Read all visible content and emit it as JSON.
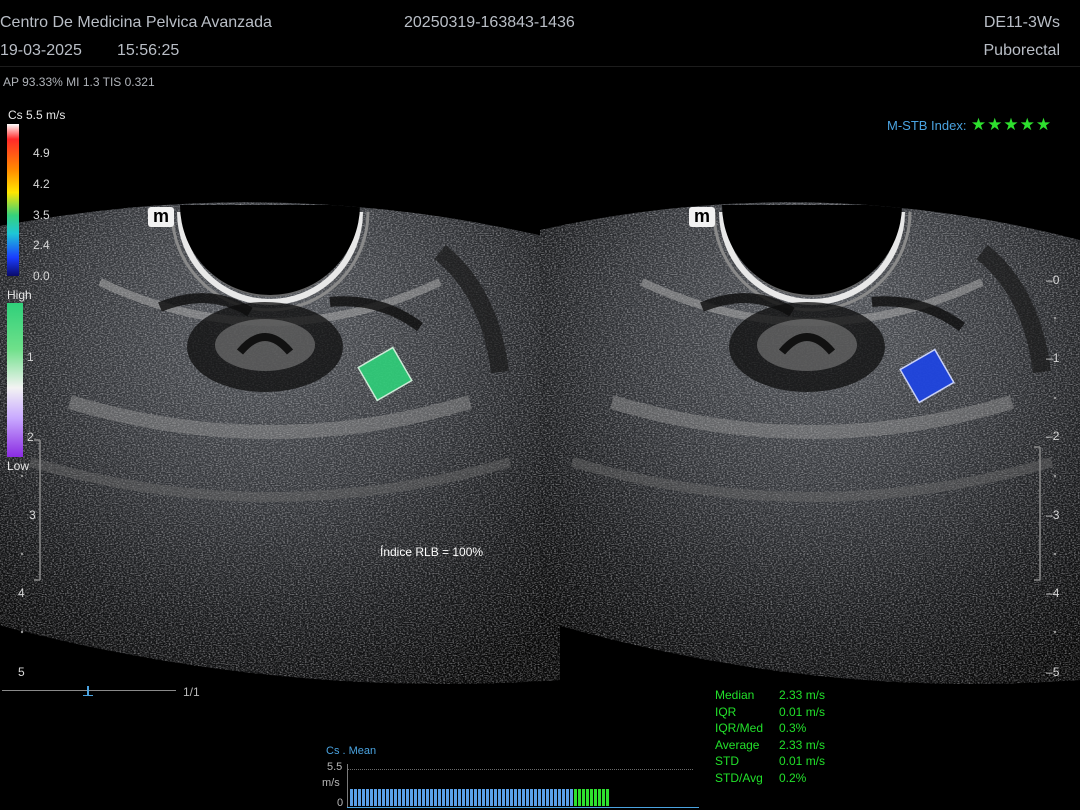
{
  "header": {
    "clinic": "Centro De Medicina Pelvica Avanzada",
    "study_id": "20250319-163843-1436",
    "probe": "DE11-3Ws",
    "date": "19-03-2025",
    "time": "15:56:25",
    "preset": "Puborectal",
    "acoustic": "AP 93.33%  MI 1.3 TIS 0.321"
  },
  "velocity_scale": {
    "title": "Cs 5.5 m/s",
    "ticks": [
      "4.9",
      "4.2",
      "3.5",
      "2.4",
      "0.0"
    ]
  },
  "quality_scale": {
    "high": "High",
    "low": "Low",
    "ticks": [
      "1",
      "2"
    ]
  },
  "stb": {
    "label": "M-STB Index:",
    "stars": "★★★★★",
    "rating": 5
  },
  "left_view": {
    "marker": "m",
    "depth_ticks": [
      "3",
      "4",
      "5"
    ],
    "rlb": "Índice RLB = 100%",
    "roi_color": "#2fd07a"
  },
  "right_view": {
    "marker": "m",
    "depth_ticks": [
      "0",
      "1",
      "2",
      "3",
      "4",
      "5"
    ],
    "roi_color": "#1f45e0"
  },
  "frame_counter": "1/1",
  "measurements": [
    {
      "label": "Median",
      "value": "2.33 m/s"
    },
    {
      "label": "IQR",
      "value": "0.01 m/s"
    },
    {
      "label": "IQR/Med",
      "value": "0.3%"
    },
    {
      "label": "Average",
      "value": "2.33 m/s"
    },
    {
      "label": "STD",
      "value": "0.01 m/s"
    },
    {
      "label": "STD/Avg",
      "value": "0.2%"
    }
  ],
  "trend": {
    "title": "Cs . Mean",
    "ymax": "5.5",
    "unit": "m/s",
    "ymin": "0",
    "blue_count": 56,
    "green_count": 9
  },
  "colors": {
    "accent_green": "#2ee02e",
    "accent_blue": "#4aa3e0"
  }
}
